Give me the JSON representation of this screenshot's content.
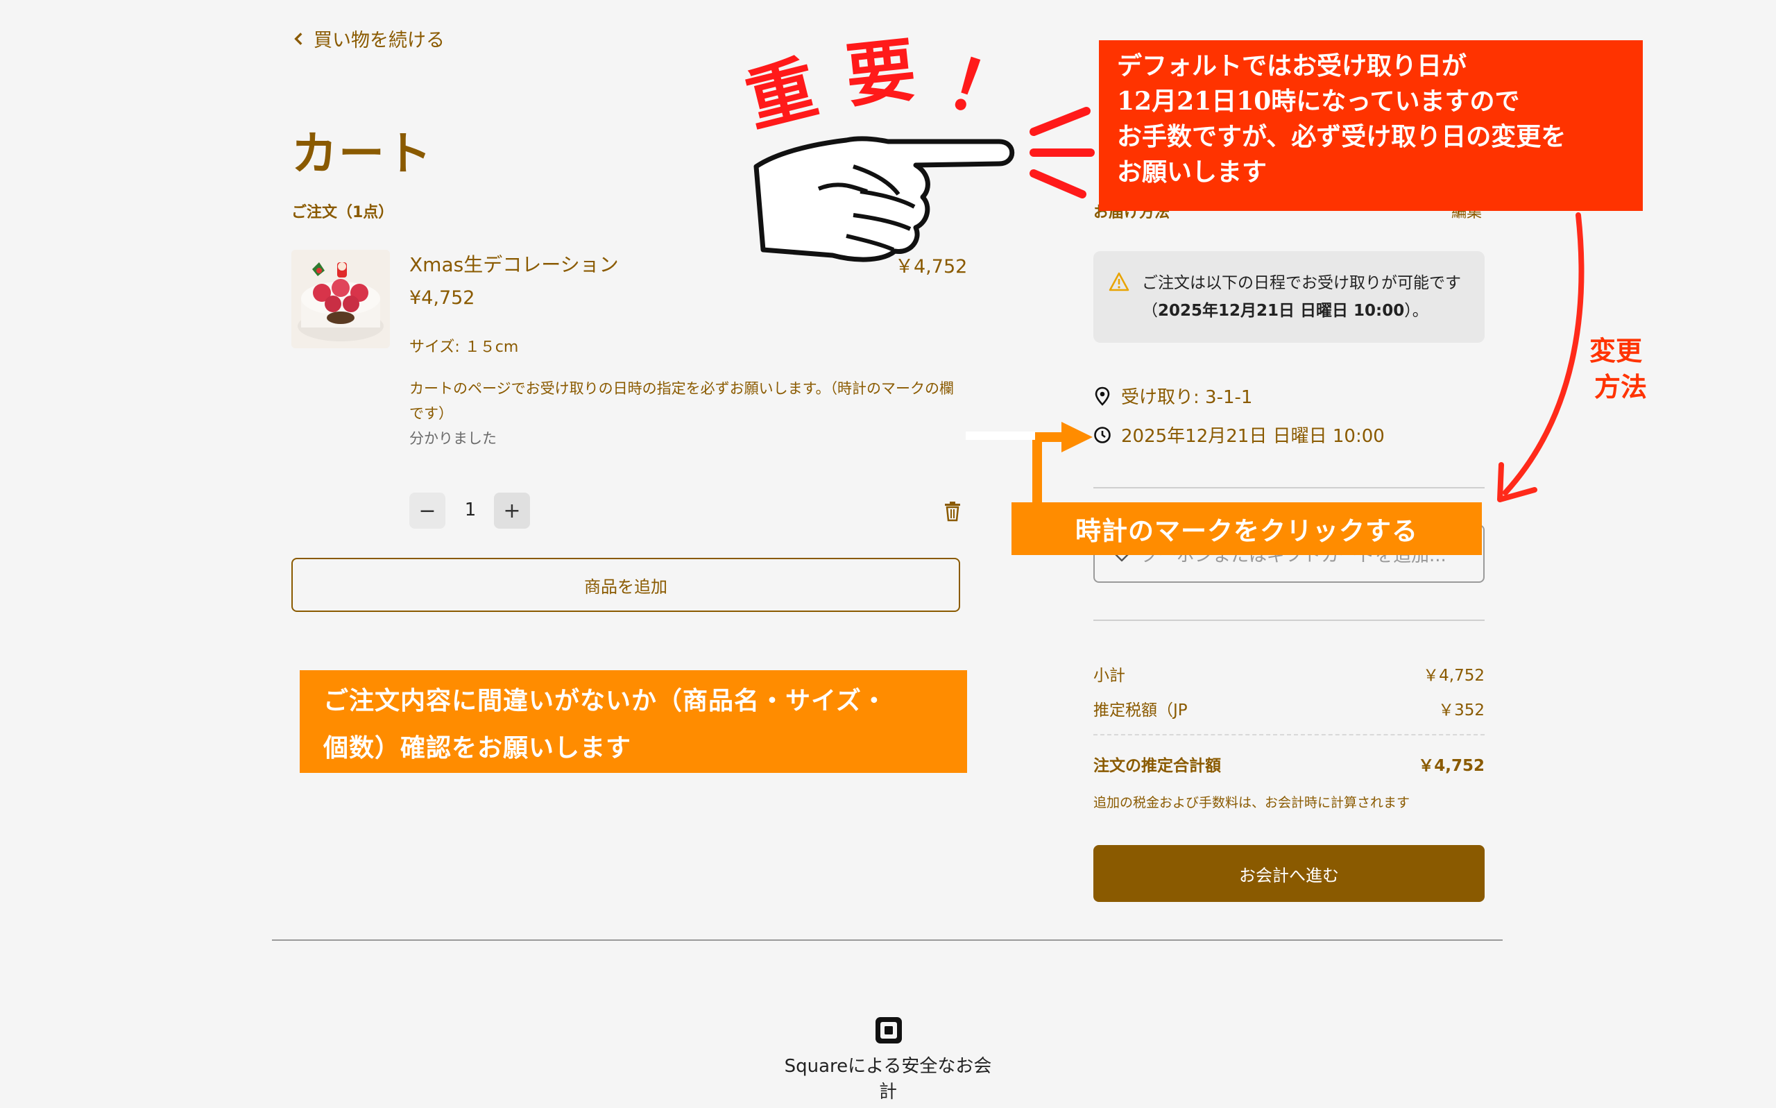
{
  "header": {
    "back_label": "買い物を続ける",
    "page_title": "カート"
  },
  "order": {
    "count_label": "ご注文（1点）",
    "item": {
      "name": "Xmas生デコレーション",
      "price": "¥4,752",
      "line_total": "￥4,752",
      "size": "サイズ: １５cm",
      "note": "カートのページでお受け取りの日時の指定を必ずお願いします。（時計のマークの欄です）",
      "note_reply": "分かりました",
      "quantity": "1",
      "decrement": "−",
      "increment": "+"
    },
    "add_item_label": "商品を追加"
  },
  "fulfillment": {
    "method_label": "お届け方法",
    "edit_label": "編集",
    "warning_text": "ご注文は以下の日程でお受け取りが可能です（",
    "warning_bold": "2025年12月21日 日曜日 10:00",
    "warning_end": "）。",
    "pickup_location": "受け取り: 3-1-1",
    "pickup_time": "2025年12月21日 日曜日 10:00"
  },
  "coupon": {
    "placeholder": "クーポンまたはギフトカードを追加..."
  },
  "summary": {
    "subtotal_label": "小計",
    "subtotal_value": "￥4,752",
    "tax_label": "推定税額（JP",
    "tax_value": "￥352",
    "total_label": "注文の推定合計額",
    "total_value": "￥4,752",
    "tax_note": "追加の税金および手数料は、お会計時に計算されます",
    "checkout_label": "お会計へ進む"
  },
  "footer": {
    "secure_label": "Squareによる安全なお会計"
  },
  "annotations": {
    "juyo_chars": [
      "重",
      "要",
      "！"
    ],
    "red_box_lines": [
      "デフォルトではお受け取り日が",
      "12月21日10時になっていますので",
      "お手数ですが、必ず受け取り日の変更を",
      "お願いします"
    ],
    "henko_lines": [
      "変更",
      "方法"
    ],
    "clock_instruction": "時計のマークをクリックする",
    "order_check_lines": [
      "ご注文内容に間違いがないか（商品名・サイズ・",
      "個数）確認をお願いします"
    ]
  },
  "colors": {
    "brand": "#8a5a00",
    "annotation_red": "#ff3300",
    "annotation_orange": "#ff8c00"
  },
  "icons": [
    "chevron-left-icon",
    "warning-icon",
    "location-pin-icon",
    "clock-icon",
    "tag-icon",
    "trash-icon",
    "square-logo-icon",
    "pointing-hand-icon"
  ]
}
